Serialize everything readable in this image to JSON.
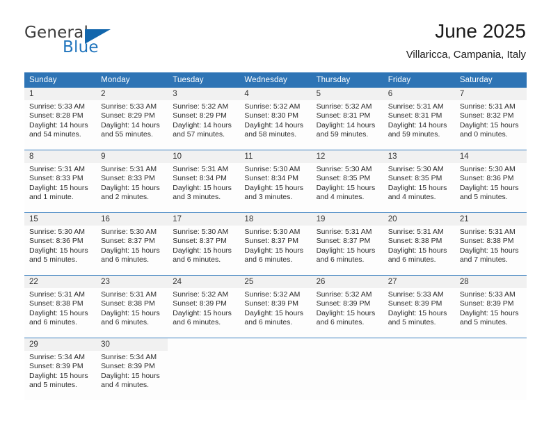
{
  "brand": {
    "name_part1": "General",
    "name_part2": "Blue",
    "logo_icon": "blue-triangle-icon"
  },
  "header": {
    "title": "June 2025",
    "subtitle": "Villaricca, Campania, Italy"
  },
  "colors": {
    "header_blue": "#2e74b5",
    "brand_blue": "#2175bd",
    "daynum_band": "#f1f1f1",
    "row_divider": "#3a7fbf"
  },
  "calendar": {
    "weekday_headers": [
      "Sunday",
      "Monday",
      "Tuesday",
      "Wednesday",
      "Thursday",
      "Friday",
      "Saturday"
    ],
    "weeks": [
      [
        {
          "day": "1",
          "sunrise": "Sunrise: 5:33 AM",
          "sunset": "Sunset: 8:28 PM",
          "daylight1": "Daylight: 14 hours",
          "daylight2": "and 54 minutes."
        },
        {
          "day": "2",
          "sunrise": "Sunrise: 5:33 AM",
          "sunset": "Sunset: 8:29 PM",
          "daylight1": "Daylight: 14 hours",
          "daylight2": "and 55 minutes."
        },
        {
          "day": "3",
          "sunrise": "Sunrise: 5:32 AM",
          "sunset": "Sunset: 8:29 PM",
          "daylight1": "Daylight: 14 hours",
          "daylight2": "and 57 minutes."
        },
        {
          "day": "4",
          "sunrise": "Sunrise: 5:32 AM",
          "sunset": "Sunset: 8:30 PM",
          "daylight1": "Daylight: 14 hours",
          "daylight2": "and 58 minutes."
        },
        {
          "day": "5",
          "sunrise": "Sunrise: 5:32 AM",
          "sunset": "Sunset: 8:31 PM",
          "daylight1": "Daylight: 14 hours",
          "daylight2": "and 59 minutes."
        },
        {
          "day": "6",
          "sunrise": "Sunrise: 5:31 AM",
          "sunset": "Sunset: 8:31 PM",
          "daylight1": "Daylight: 14 hours",
          "daylight2": "and 59 minutes."
        },
        {
          "day": "7",
          "sunrise": "Sunrise: 5:31 AM",
          "sunset": "Sunset: 8:32 PM",
          "daylight1": "Daylight: 15 hours",
          "daylight2": "and 0 minutes."
        }
      ],
      [
        {
          "day": "8",
          "sunrise": "Sunrise: 5:31 AM",
          "sunset": "Sunset: 8:33 PM",
          "daylight1": "Daylight: 15 hours",
          "daylight2": "and 1 minute."
        },
        {
          "day": "9",
          "sunrise": "Sunrise: 5:31 AM",
          "sunset": "Sunset: 8:33 PM",
          "daylight1": "Daylight: 15 hours",
          "daylight2": "and 2 minutes."
        },
        {
          "day": "10",
          "sunrise": "Sunrise: 5:31 AM",
          "sunset": "Sunset: 8:34 PM",
          "daylight1": "Daylight: 15 hours",
          "daylight2": "and 3 minutes."
        },
        {
          "day": "11",
          "sunrise": "Sunrise: 5:30 AM",
          "sunset": "Sunset: 8:34 PM",
          "daylight1": "Daylight: 15 hours",
          "daylight2": "and 3 minutes."
        },
        {
          "day": "12",
          "sunrise": "Sunrise: 5:30 AM",
          "sunset": "Sunset: 8:35 PM",
          "daylight1": "Daylight: 15 hours",
          "daylight2": "and 4 minutes."
        },
        {
          "day": "13",
          "sunrise": "Sunrise: 5:30 AM",
          "sunset": "Sunset: 8:35 PM",
          "daylight1": "Daylight: 15 hours",
          "daylight2": "and 4 minutes."
        },
        {
          "day": "14",
          "sunrise": "Sunrise: 5:30 AM",
          "sunset": "Sunset: 8:36 PM",
          "daylight1": "Daylight: 15 hours",
          "daylight2": "and 5 minutes."
        }
      ],
      [
        {
          "day": "15",
          "sunrise": "Sunrise: 5:30 AM",
          "sunset": "Sunset: 8:36 PM",
          "daylight1": "Daylight: 15 hours",
          "daylight2": "and 5 minutes."
        },
        {
          "day": "16",
          "sunrise": "Sunrise: 5:30 AM",
          "sunset": "Sunset: 8:37 PM",
          "daylight1": "Daylight: 15 hours",
          "daylight2": "and 6 minutes."
        },
        {
          "day": "17",
          "sunrise": "Sunrise: 5:30 AM",
          "sunset": "Sunset: 8:37 PM",
          "daylight1": "Daylight: 15 hours",
          "daylight2": "and 6 minutes."
        },
        {
          "day": "18",
          "sunrise": "Sunrise: 5:30 AM",
          "sunset": "Sunset: 8:37 PM",
          "daylight1": "Daylight: 15 hours",
          "daylight2": "and 6 minutes."
        },
        {
          "day": "19",
          "sunrise": "Sunrise: 5:31 AM",
          "sunset": "Sunset: 8:37 PM",
          "daylight1": "Daylight: 15 hours",
          "daylight2": "and 6 minutes."
        },
        {
          "day": "20",
          "sunrise": "Sunrise: 5:31 AM",
          "sunset": "Sunset: 8:38 PM",
          "daylight1": "Daylight: 15 hours",
          "daylight2": "and 6 minutes."
        },
        {
          "day": "21",
          "sunrise": "Sunrise: 5:31 AM",
          "sunset": "Sunset: 8:38 PM",
          "daylight1": "Daylight: 15 hours",
          "daylight2": "and 7 minutes."
        }
      ],
      [
        {
          "day": "22",
          "sunrise": "Sunrise: 5:31 AM",
          "sunset": "Sunset: 8:38 PM",
          "daylight1": "Daylight: 15 hours",
          "daylight2": "and 6 minutes."
        },
        {
          "day": "23",
          "sunrise": "Sunrise: 5:31 AM",
          "sunset": "Sunset: 8:38 PM",
          "daylight1": "Daylight: 15 hours",
          "daylight2": "and 6 minutes."
        },
        {
          "day": "24",
          "sunrise": "Sunrise: 5:32 AM",
          "sunset": "Sunset: 8:39 PM",
          "daylight1": "Daylight: 15 hours",
          "daylight2": "and 6 minutes."
        },
        {
          "day": "25",
          "sunrise": "Sunrise: 5:32 AM",
          "sunset": "Sunset: 8:39 PM",
          "daylight1": "Daylight: 15 hours",
          "daylight2": "and 6 minutes."
        },
        {
          "day": "26",
          "sunrise": "Sunrise: 5:32 AM",
          "sunset": "Sunset: 8:39 PM",
          "daylight1": "Daylight: 15 hours",
          "daylight2": "and 6 minutes."
        },
        {
          "day": "27",
          "sunrise": "Sunrise: 5:33 AM",
          "sunset": "Sunset: 8:39 PM",
          "daylight1": "Daylight: 15 hours",
          "daylight2": "and 5 minutes."
        },
        {
          "day": "28",
          "sunrise": "Sunrise: 5:33 AM",
          "sunset": "Sunset: 8:39 PM",
          "daylight1": "Daylight: 15 hours",
          "daylight2": "and 5 minutes."
        }
      ],
      [
        {
          "day": "29",
          "sunrise": "Sunrise: 5:34 AM",
          "sunset": "Sunset: 8:39 PM",
          "daylight1": "Daylight: 15 hours",
          "daylight2": "and 5 minutes."
        },
        {
          "day": "30",
          "sunrise": "Sunrise: 5:34 AM",
          "sunset": "Sunset: 8:39 PM",
          "daylight1": "Daylight: 15 hours",
          "daylight2": "and 4 minutes."
        },
        {
          "day": "",
          "sunrise": "",
          "sunset": "",
          "daylight1": "",
          "daylight2": ""
        },
        {
          "day": "",
          "sunrise": "",
          "sunset": "",
          "daylight1": "",
          "daylight2": ""
        },
        {
          "day": "",
          "sunrise": "",
          "sunset": "",
          "daylight1": "",
          "daylight2": ""
        },
        {
          "day": "",
          "sunrise": "",
          "sunset": "",
          "daylight1": "",
          "daylight2": ""
        },
        {
          "day": "",
          "sunrise": "",
          "sunset": "",
          "daylight1": "",
          "daylight2": ""
        }
      ]
    ]
  }
}
